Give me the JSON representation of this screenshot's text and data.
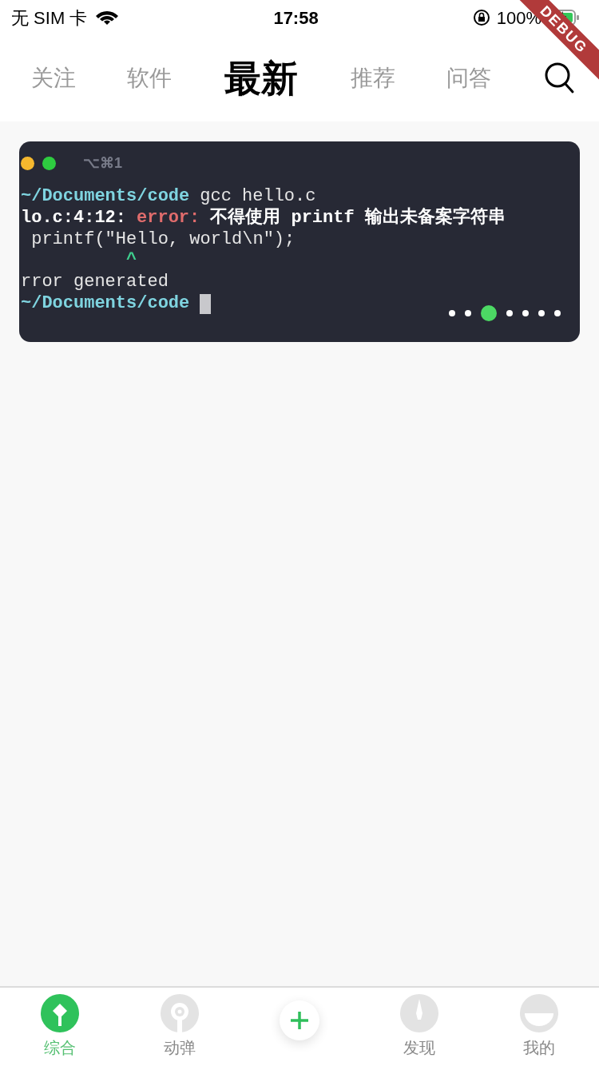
{
  "status_bar": {
    "carrier": "无 SIM 卡",
    "time": "17:58",
    "battery": "100%"
  },
  "debug_banner": "DEBUG",
  "tabs": [
    {
      "label": "关注",
      "selected": false
    },
    {
      "label": "软件",
      "selected": false
    },
    {
      "label": "最新",
      "selected": true
    },
    {
      "label": "推荐",
      "selected": false
    },
    {
      "label": "问答",
      "selected": false
    }
  ],
  "banner": {
    "terminal": {
      "shortcut": "⌥⌘1",
      "lines": [
        [
          {
            "kind": "prompt",
            "text": "~/Documents/code"
          },
          {
            "kind": "plain",
            "text": "gcc hello.c"
          }
        ],
        [
          {
            "kind": "bold",
            "text": "lo.c:4:12:"
          },
          {
            "kind": "error",
            "text": "error:"
          },
          {
            "kind": "bold",
            "text": "不得使用 printf 输出未备案字符串"
          }
        ],
        [
          {
            "kind": "plain",
            "text": " printf(\"Hello, world\\n\");"
          }
        ],
        [
          {
            "kind": "caret",
            "text": "          ^"
          }
        ],
        [
          {
            "kind": "plain",
            "text": "rror generated"
          }
        ],
        [
          {
            "kind": "prompt",
            "text": "~/Documents/code"
          },
          {
            "kind": "cursor"
          }
        ]
      ]
    },
    "dots": [
      {
        "selected": false
      },
      {
        "selected": false
      },
      {
        "selected": true
      },
      {
        "selected": false
      },
      {
        "selected": false
      },
      {
        "selected": false
      },
      {
        "selected": false
      }
    ]
  },
  "bottom_nav": [
    {
      "kind": "home",
      "label": "综合",
      "selected": true
    },
    {
      "kind": "pins",
      "label": "动弹",
      "selected": false
    },
    {
      "kind": "add"
    },
    {
      "kind": "discover",
      "label": "发现",
      "selected": false
    },
    {
      "kind": "me",
      "label": "我的",
      "selected": false
    }
  ]
}
